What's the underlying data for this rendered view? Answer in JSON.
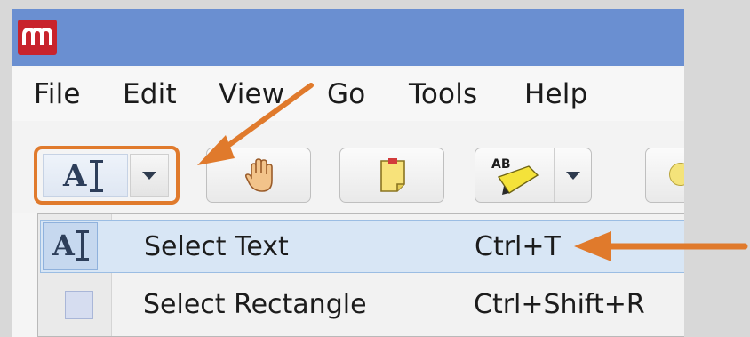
{
  "menu": {
    "items": [
      {
        "label": "File"
      },
      {
        "label": "Edit"
      },
      {
        "label": "View"
      },
      {
        "label": "Go"
      },
      {
        "label": "Tools"
      },
      {
        "label": "Help"
      }
    ]
  },
  "toolbar": {
    "tools": [
      "select-text-tool",
      "hand-tool",
      "note-tool",
      "highlight-tool"
    ]
  },
  "dropdown": {
    "items": [
      {
        "label": "Select Text",
        "shortcut": "Ctrl+T",
        "icon": "select-text-icon",
        "highlighted": true
      },
      {
        "label": "Select Rectangle",
        "shortcut": "Ctrl+Shift+R",
        "icon": "select-rectangle-icon",
        "highlighted": false
      }
    ]
  },
  "colors": {
    "titlebar": "#6a8fd1",
    "app_logo": "#c8232c",
    "annotation": "#e07a2c",
    "highlight_row": "#d8e6f5"
  }
}
